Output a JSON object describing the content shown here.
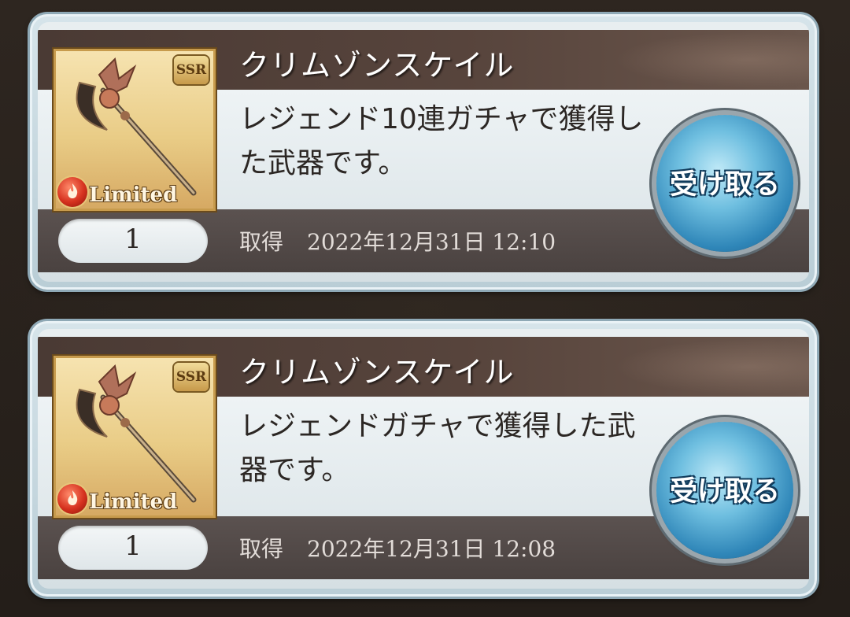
{
  "items": [
    {
      "name": "クリムゾンスケイル",
      "description": "レジェンド10連ガチャで獲得した武器です。",
      "rarity": "SSR",
      "tag": "Limited",
      "quantity": "1",
      "acquired_label": "取得",
      "acquired_at": "2022年12月31日 12:10",
      "claim_label": "受け取る",
      "icon": "crimson-scythe-weapon-icon"
    },
    {
      "name": "クリムゾンスケイル",
      "description": "レジェンドガチャで獲得した武器です。",
      "rarity": "SSR",
      "tag": "Limited",
      "quantity": "1",
      "acquired_label": "取得",
      "acquired_at": "2022年12月31日 12:08",
      "claim_label": "受け取る",
      "icon": "crimson-scythe-weapon-icon"
    }
  ],
  "colors": {
    "title_bar": "#4a3a34",
    "claim_button": "#2f86b8",
    "card_frame": "#b9cdd6"
  }
}
